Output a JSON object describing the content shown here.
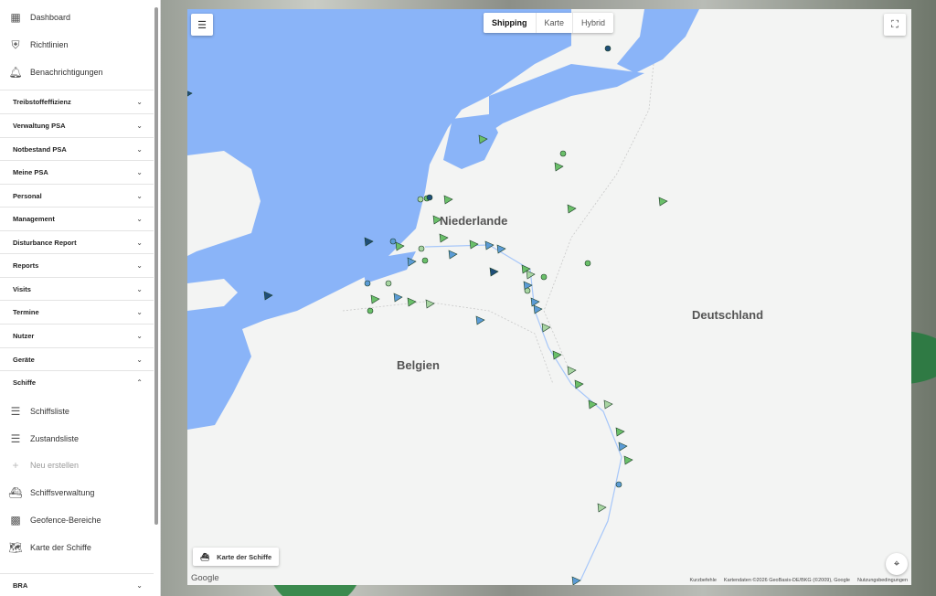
{
  "sidebar": {
    "top_items": [
      {
        "label": "Dashboard",
        "icon": "dashboard-icon"
      },
      {
        "label": "Richtlinien",
        "icon": "shield-icon"
      },
      {
        "label": "Benachrichtigungen",
        "icon": "bell-icon"
      }
    ],
    "sections": [
      {
        "label": "Treibstoffeffizienz",
        "expanded": false
      },
      {
        "label": "Verwaltung PSA",
        "expanded": false
      },
      {
        "label": "Notbestand PSA",
        "expanded": false
      },
      {
        "label": "Meine PSA",
        "expanded": false
      },
      {
        "label": "Personal",
        "expanded": false
      },
      {
        "label": "Management",
        "expanded": false
      },
      {
        "label": "Disturbance Report",
        "expanded": false
      },
      {
        "label": "Reports",
        "expanded": false
      },
      {
        "label": "Visits",
        "expanded": false
      },
      {
        "label": "Termine",
        "expanded": false
      },
      {
        "label": "Nutzer",
        "expanded": false
      },
      {
        "label": "Geräte",
        "expanded": false
      },
      {
        "label": "Schiffe",
        "expanded": true
      }
    ],
    "schiffe_items": [
      {
        "label": "Schiffsliste",
        "icon": "list-icon",
        "disabled": false
      },
      {
        "label": "Zustandsliste",
        "icon": "list-icon",
        "disabled": false
      },
      {
        "label": "Neu erstellen",
        "icon": "plus-icon",
        "disabled": true
      },
      {
        "label": "Schiffsverwaltung",
        "icon": "ship-icon",
        "disabled": false
      },
      {
        "label": "Geofence-Bereiche",
        "icon": "geofence-icon",
        "disabled": false
      },
      {
        "label": "Karte der Schiffe",
        "icon": "map-icon",
        "disabled": false
      }
    ],
    "bottom_section": {
      "label": "BRA",
      "expanded": false
    }
  },
  "map": {
    "map_types": [
      {
        "label": "Shipping",
        "active": true
      },
      {
        "label": "Karte",
        "active": false
      },
      {
        "label": "Hybrid",
        "active": false
      }
    ],
    "countries": [
      "Niederlande",
      "Deutschland",
      "Belgien"
    ],
    "layer_label": "Karte der Schiffe",
    "google_logo": "Google",
    "attribution": [
      "Kurzbefehle",
      "Kartendaten ©2026 GeoBasis-DE/BKG (©2009), Google",
      "Nutzungsbedingungen"
    ],
    "colors": {
      "water": "#8ab4f8",
      "land": "#f3f4f3",
      "ship_green": "#6abf69",
      "ship_light": "#a8d5a2",
      "ship_blue": "#5b9bd5",
      "ship_dark": "#1f4e79"
    }
  }
}
